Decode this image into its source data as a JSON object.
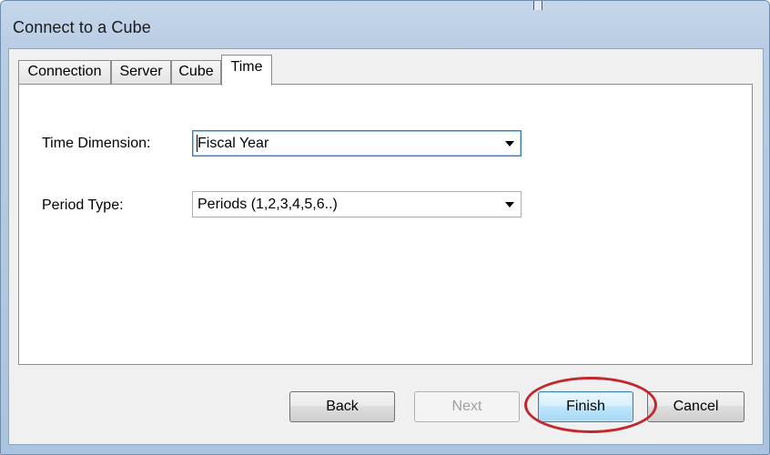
{
  "window": {
    "title": "Connect to a Cube"
  },
  "tabs": [
    {
      "label": "Connection",
      "active": false
    },
    {
      "label": "Server",
      "active": false
    },
    {
      "label": "Cube",
      "active": false
    },
    {
      "label": "Time",
      "active": true
    }
  ],
  "fields": {
    "time_dimension": {
      "label": "Time Dimension:",
      "value": "Fiscal Year"
    },
    "period_type": {
      "label": "Period Type:",
      "value": "Periods (1,2,3,4,5,6..)"
    }
  },
  "buttons": {
    "back": "Back",
    "next": "Next",
    "finish": "Finish",
    "cancel": "Cancel"
  },
  "colors": {
    "highlight": "#c0282d",
    "focus_border": "#3c7fb1"
  }
}
